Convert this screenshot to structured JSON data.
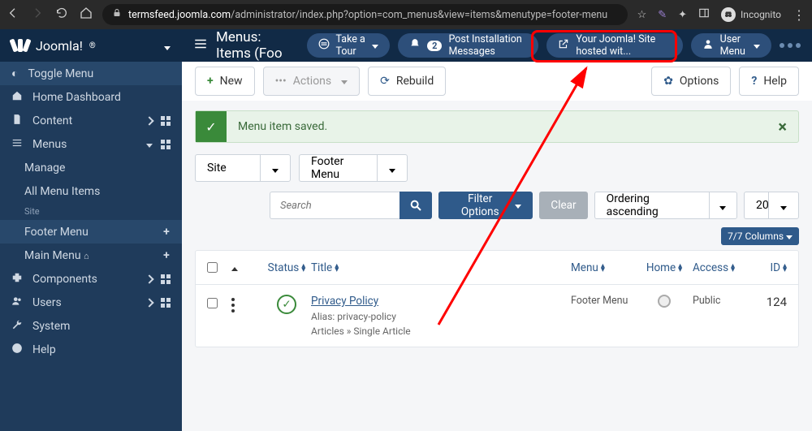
{
  "browser": {
    "url_host": "termsfeed.joomla.com",
    "url_path": "/administrator/index.php?option=com_menus&view=items&menutype=footer-menu",
    "incognito": "Incognito"
  },
  "brand": "Joomla!",
  "page_title": "Menus: Items (Foo",
  "header_pills": {
    "tour": "Take a Tour",
    "notif_count": "2",
    "notif_label": "Post Installation Messages",
    "site_link": "Your Joomla! Site hosted wit...",
    "user_menu": "User Menu"
  },
  "sidebar": {
    "toggle": "Toggle Menu",
    "items": [
      {
        "label": "Home Dashboard"
      },
      {
        "label": "Content"
      },
      {
        "label": "Menus"
      },
      {
        "label": "Components"
      },
      {
        "label": "Users"
      },
      {
        "label": "System"
      },
      {
        "label": "Help"
      }
    ],
    "menu_sub": {
      "manage": "Manage",
      "all": "All Menu Items",
      "sep": "Site",
      "footer": "Footer Menu",
      "main": "Main Menu"
    }
  },
  "toolbar": {
    "new": "New",
    "actions": "Actions",
    "rebuild": "Rebuild",
    "options": "Options",
    "help": "Help"
  },
  "alert_msg": "Menu item saved.",
  "selectors": {
    "site": "Site",
    "footer": "Footer Menu"
  },
  "filters": {
    "search_placeholder": "Search",
    "filter_options": "Filter Options",
    "clear": "Clear",
    "ordering": "Ordering ascending",
    "limit": "20",
    "columns": "7/7 Columns"
  },
  "table": {
    "headers": {
      "status": "Status",
      "title": "Title",
      "menu": "Menu",
      "home": "Home",
      "access": "Access",
      "id": "ID"
    },
    "row": {
      "title": "Privacy Policy",
      "alias": "Alias: privacy-policy",
      "path": "Articles » Single Article",
      "menu": "Footer Menu",
      "access": "Public",
      "id": "124"
    }
  }
}
